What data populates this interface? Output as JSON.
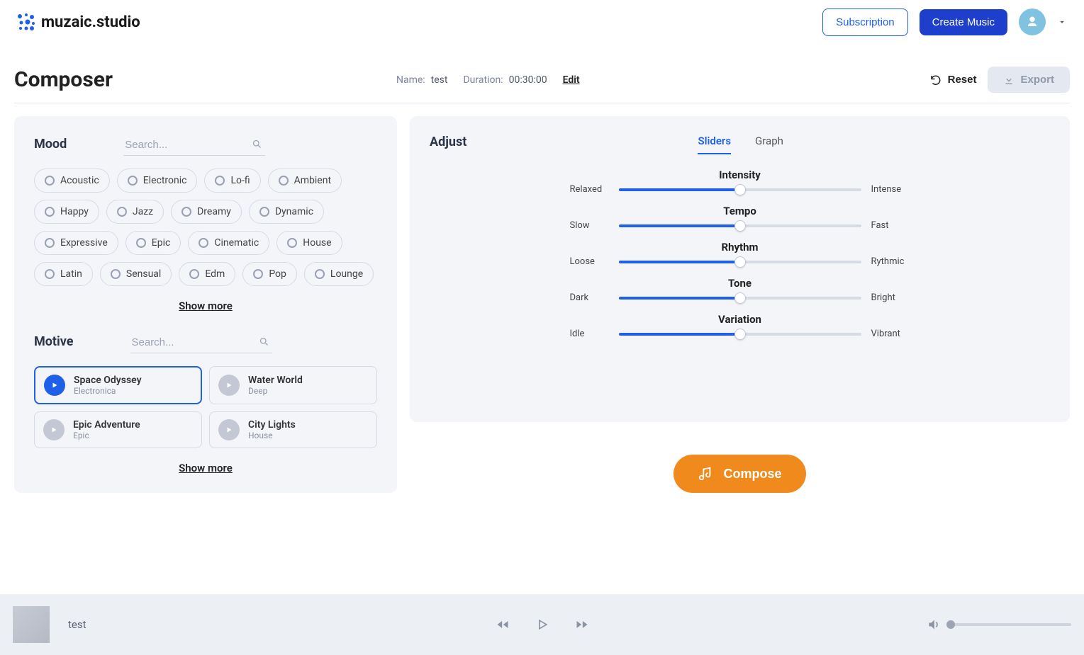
{
  "brand": "muzaic.studio",
  "topbar": {
    "subscription": "Subscription",
    "create": "Create Music"
  },
  "page_title": "Composer",
  "meta": {
    "name_label": "Name:",
    "name_value": "test",
    "duration_label": "Duration:",
    "duration_value": "00:30:00",
    "edit": "Edit",
    "reset": "Reset",
    "export": "Export"
  },
  "mood": {
    "title": "Mood",
    "search_placeholder": "Search...",
    "tags": [
      "Acoustic",
      "Electronic",
      "Lo-fi",
      "Ambient",
      "Happy",
      "Jazz",
      "Dreamy",
      "Dynamic",
      "Expressive",
      "Epic",
      "Cinematic",
      "House",
      "Latin",
      "Sensual",
      "Edm",
      "Pop",
      "Lounge"
    ],
    "show_more": "Show more"
  },
  "motive": {
    "title": "Motive",
    "search_placeholder": "Search...",
    "items": [
      {
        "title": "Space Odyssey",
        "sub": "Electronica",
        "selected": true
      },
      {
        "title": "Water World",
        "sub": "Deep",
        "selected": false
      },
      {
        "title": "Epic Adventure",
        "sub": "Epic",
        "selected": false
      },
      {
        "title": "City Lights",
        "sub": "House",
        "selected": false
      }
    ],
    "show_more": "Show more"
  },
  "adjust": {
    "title": "Adjust",
    "tabs": {
      "sliders": "Sliders",
      "graph": "Graph"
    },
    "sliders": [
      {
        "name": "Intensity",
        "low": "Relaxed",
        "high": "Intense",
        "pct": 50
      },
      {
        "name": "Tempo",
        "low": "Slow",
        "high": "Fast",
        "pct": 50
      },
      {
        "name": "Rhythm",
        "low": "Loose",
        "high": "Rythmic",
        "pct": 50
      },
      {
        "name": "Tone",
        "low": "Dark",
        "high": "Bright",
        "pct": 50
      },
      {
        "name": "Variation",
        "low": "Idle",
        "high": "Vibrant",
        "pct": 50
      }
    ]
  },
  "compose": "Compose",
  "player": {
    "title": "test"
  }
}
